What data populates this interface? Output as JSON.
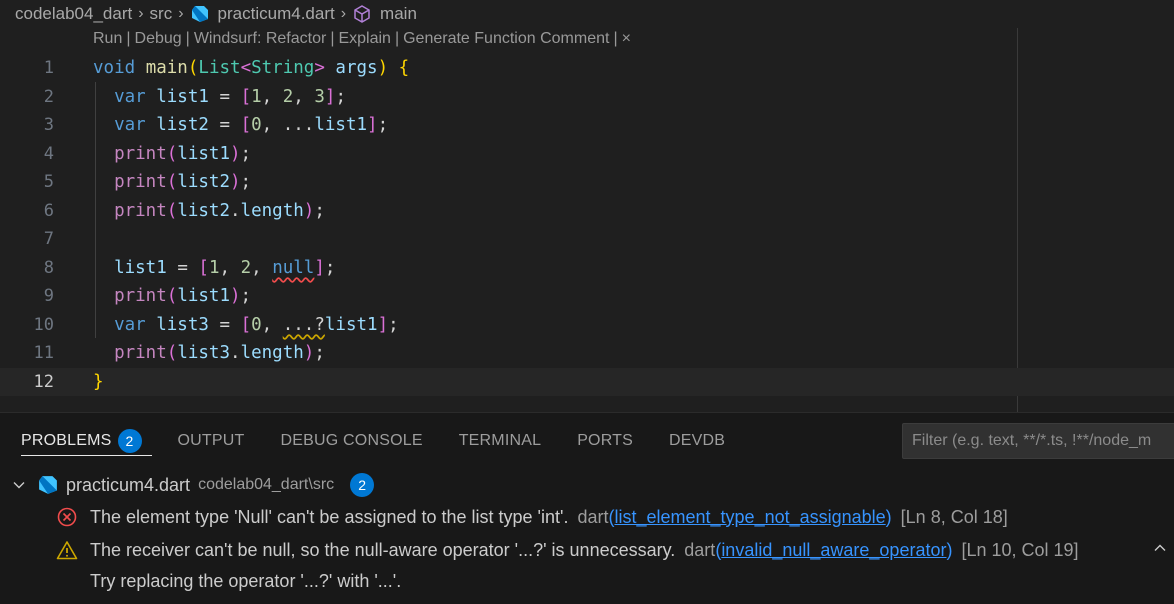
{
  "breadcrumb": {
    "folder": "codelab04_dart",
    "subfolder": "src",
    "file": "practicum4.dart",
    "symbol": "main"
  },
  "codelens": {
    "items": [
      "Run",
      "Debug",
      "Windsurf: Refactor",
      "Explain",
      "Generate Function Comment"
    ],
    "separator": "|",
    "close": "×"
  },
  "editor": {
    "line_numbers": [
      "1",
      "2",
      "3",
      "4",
      "5",
      "6",
      "7",
      "8",
      "9",
      "10",
      "11",
      "12"
    ],
    "current_line": 12
  },
  "panel": {
    "tabs": {
      "problems": "PROBLEMS",
      "problems_count": "2",
      "output": "OUTPUT",
      "debug_console": "DEBUG CONSOLE",
      "terminal": "TERMINAL",
      "ports": "PORTS",
      "devdb": "DEVDB"
    },
    "filter_placeholder": "Filter (e.g. text, **/*.ts, !**/node_m",
    "file": {
      "name": "practicum4.dart",
      "path": "codelab04_dart\\src",
      "count": "2"
    },
    "problems": [
      {
        "severity": "error",
        "message": "The element type 'Null' can't be assigned to the list type 'int'.",
        "source": "dart",
        "code": "list_element_type_not_assignable",
        "location": "[Ln 8, Col 18]"
      },
      {
        "severity": "warning",
        "message": "The receiver can't be null, so the null-aware operator '...?' is unnecessary.",
        "source": "dart",
        "code": "invalid_null_aware_operator",
        "location": "[Ln 10, Col 19]"
      }
    ],
    "hint": "Try replacing the operator '...?' with '...'."
  },
  "colors": {
    "accent": "#0078d4",
    "error": "#f14c4c",
    "warning": "#cca700",
    "link": "#3794ff"
  }
}
